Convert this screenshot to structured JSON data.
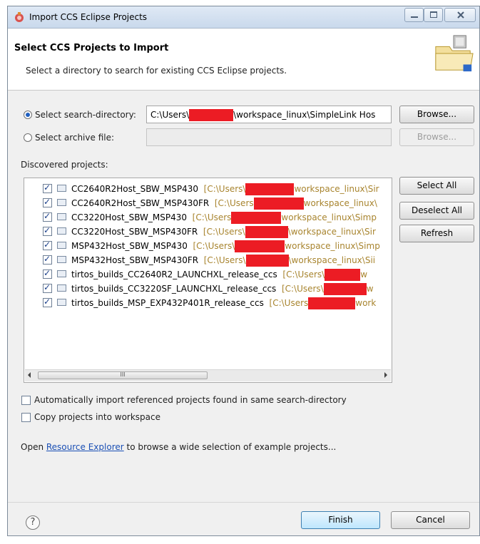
{
  "window": {
    "title": "Import CCS Eclipse Projects"
  },
  "header": {
    "title": "Select CCS Projects to Import",
    "description": "Select a directory to search for existing CCS Eclipse projects."
  },
  "search_directory": {
    "label": "Select search-directory:",
    "value_prefix": "C:\\Users\\",
    "value_suffix": "\\workspace_linux\\SimpleLink Hos",
    "browse_label": "Browse..."
  },
  "archive_file": {
    "label": "Select archive file:",
    "value": "",
    "browse_label": "Browse..."
  },
  "discovered": {
    "label": "Discovered projects:",
    "projects": [
      {
        "name": "CC2640R2Host_SBW_MSP430",
        "path_prefix": "[C:\\Users\\",
        "path_suffix": "workspace_linux\\Sir",
        "checked": true
      },
      {
        "name": "CC2640R2Host_SBW_MSP430FR",
        "path_prefix": "[C:\\Users",
        "path_suffix": "workspace_linux\\",
        "checked": true
      },
      {
        "name": "CC3220Host_SBW_MSP430",
        "path_prefix": "[C:\\Users",
        "path_suffix": "workspace_linux\\Simp",
        "checked": true
      },
      {
        "name": "CC3220Host_SBW_MSP430FR",
        "path_prefix": "[C:\\Users\\",
        "path_suffix": "\\workspace_linux\\Sir",
        "checked": true
      },
      {
        "name": "MSP432Host_SBW_MSP430",
        "path_prefix": "[C:\\Users\\",
        "path_suffix": "workspace_linux\\Simp",
        "checked": true
      },
      {
        "name": "MSP432Host_SBW_MSP430FR",
        "path_prefix": "[C:\\Users\\",
        "path_suffix": "\\workspace_linux\\Sii",
        "checked": true
      },
      {
        "name": "tirtos_builds_CC2640R2_LAUNCHXL_release_ccs",
        "path_prefix": "[C:\\Users\\",
        "path_suffix": "w",
        "checked": true
      },
      {
        "name": "tirtos_builds_CC3220SF_LAUNCHXL_release_ccs",
        "path_prefix": "[C:\\Users\\",
        "path_suffix": "w",
        "checked": true
      },
      {
        "name": "tirtos_builds_MSP_EXP432P401R_release_ccs",
        "path_prefix": "[C:\\Users",
        "path_suffix": "work",
        "checked": true
      }
    ],
    "scroll_thumb_glyph": "III"
  },
  "side_buttons": {
    "select_all": "Select All",
    "deselect_all": "Deselect All",
    "refresh": "Refresh"
  },
  "options": {
    "auto_import": {
      "label": "Automatically import referenced projects found in same search-directory",
      "checked": false
    },
    "copy_projects": {
      "label": "Copy projects into workspace",
      "checked": false
    }
  },
  "footer_text": {
    "prefix": "Open ",
    "link": "Resource Explorer",
    "suffix": " to browse a wide selection of example projects..."
  },
  "bottom": {
    "help_glyph": "?",
    "finish": "Finish",
    "cancel": "Cancel"
  },
  "colors": {
    "redaction": "#ec1c24",
    "path_text": "#a8842e",
    "link": "#1a4fb5"
  },
  "icons": [
    "app-icon",
    "minimize-icon",
    "maximize-icon",
    "close-icon",
    "import-wizard-icon",
    "folder-icon",
    "help-icon",
    "scroll-left-icon",
    "scroll-right-icon"
  ]
}
